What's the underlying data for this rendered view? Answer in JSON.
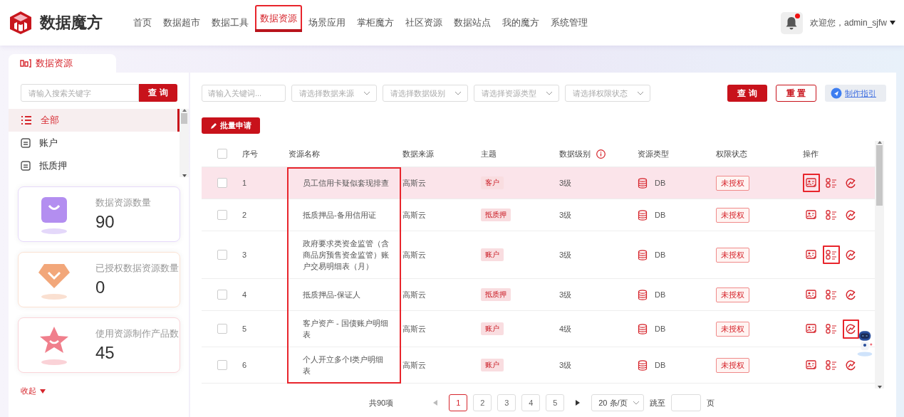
{
  "brand": {
    "name": "数据魔方"
  },
  "nav": [
    {
      "label": "首页",
      "selected": false,
      "annotated": false
    },
    {
      "label": "数据超市",
      "selected": false,
      "annotated": false
    },
    {
      "label": "数据工具",
      "selected": false,
      "annotated": false
    },
    {
      "label": "数据资源",
      "selected": true,
      "annotated": true
    },
    {
      "label": "场景应用",
      "selected": false,
      "annotated": false
    },
    {
      "label": "掌柜魔方",
      "selected": false,
      "annotated": false
    },
    {
      "label": "社区资源",
      "selected": false,
      "annotated": false
    },
    {
      "label": "数据站点",
      "selected": false,
      "annotated": false
    },
    {
      "label": "我的魔方",
      "selected": false,
      "annotated": false
    },
    {
      "label": "系统管理",
      "selected": false,
      "annotated": false
    }
  ],
  "user": {
    "notification": true,
    "welcome": "欢迎您，admin_sjfw"
  },
  "sidebar": {
    "tab": "数据资源",
    "search": {
      "placeholder": "请输入搜索关键字",
      "button": "查 询"
    },
    "categories": [
      {
        "label": "全部",
        "kind": "all",
        "selected": true
      },
      {
        "label": "账户",
        "kind": "table",
        "selected": false
      },
      {
        "label": "抵质押",
        "kind": "table",
        "selected": false
      }
    ],
    "stats": [
      {
        "label": "数据资源数量",
        "value": "90",
        "kind": "bag",
        "color": "#b38ef0"
      },
      {
        "label": "已授权数据资源数量",
        "value": "0",
        "kind": "gem",
        "color": "#f2a77a"
      },
      {
        "label": "使用资源制作产品数",
        "value": "45",
        "kind": "star",
        "color": "#f07f8c"
      }
    ],
    "collapse": "收起"
  },
  "filters": {
    "keyword_placeholder": "请输入关键词...",
    "selects": [
      "请选择数据来源",
      "请选择数据级别",
      "请选择资源类型",
      "请选择权限状态"
    ],
    "query": "查 询",
    "reset": "重 置",
    "guide": "制作指引"
  },
  "batch_button": "批量申请",
  "table": {
    "columns": [
      "序号",
      "资源名称",
      "数据来源",
      "主题",
      "数据级别",
      "资源类型",
      "权限状态",
      "操作"
    ],
    "name_column_annotated": true,
    "select_all_checked": false,
    "rows": [
      {
        "index": "1",
        "name": "员工信用卡疑似套现排查",
        "source": "高斯云",
        "topic": "客户",
        "level": "3级",
        "type": "DB",
        "status": "未授权",
        "checked": false,
        "highlighted": true,
        "actions": [
          {
            "kind": "card",
            "annotated": true
          },
          {
            "kind": "list",
            "annotated": false
          },
          {
            "kind": "chart",
            "annotated": false
          }
        ]
      },
      {
        "index": "2",
        "name": "抵质押品-备用信用证",
        "source": "高斯云",
        "topic": "抵质押",
        "level": "3级",
        "type": "DB",
        "status": "未授权",
        "checked": false,
        "highlighted": false,
        "actions": [
          {
            "kind": "card",
            "annotated": false
          },
          {
            "kind": "list",
            "annotated": false
          },
          {
            "kind": "chart",
            "annotated": false
          }
        ]
      },
      {
        "index": "3",
        "name": "政府要求类资金监管（含商品房预售资金监管）账户交易明细表（月）",
        "source": "高斯云",
        "topic": "账户",
        "level": "3级",
        "type": "DB",
        "status": "未授权",
        "checked": false,
        "highlighted": false,
        "actions": [
          {
            "kind": "card",
            "annotated": false
          },
          {
            "kind": "list",
            "annotated": true
          },
          {
            "kind": "chart",
            "annotated": false
          }
        ]
      },
      {
        "index": "4",
        "name": "抵质押品-保证人",
        "source": "高斯云",
        "topic": "抵质押",
        "level": "3级",
        "type": "DB",
        "status": "未授权",
        "checked": false,
        "highlighted": false,
        "actions": [
          {
            "kind": "card",
            "annotated": false
          },
          {
            "kind": "list",
            "annotated": false
          },
          {
            "kind": "chart",
            "annotated": false
          }
        ]
      },
      {
        "index": "5",
        "name": "客户资产 - 国债账户明细表",
        "source": "高斯云",
        "topic": "账户",
        "level": "4级",
        "type": "DB",
        "status": "未授权",
        "checked": false,
        "highlighted": false,
        "actions": [
          {
            "kind": "card",
            "annotated": false
          },
          {
            "kind": "list",
            "annotated": false
          },
          {
            "kind": "chart",
            "annotated": true
          }
        ]
      },
      {
        "index": "6",
        "name": "个人开立多个Ⅰ类户明细表",
        "source": "高斯云",
        "topic": "账户",
        "level": "3级",
        "type": "DB",
        "status": "未授权",
        "checked": false,
        "highlighted": false,
        "actions": [
          {
            "kind": "card",
            "annotated": false
          },
          {
            "kind": "list",
            "annotated": false
          },
          {
            "kind": "chart",
            "annotated": false
          }
        ]
      }
    ]
  },
  "pagination": {
    "total": "共90项",
    "pages": [
      {
        "label": "1",
        "selected": true
      },
      {
        "label": "2",
        "selected": false
      },
      {
        "label": "3",
        "selected": false
      },
      {
        "label": "4",
        "selected": false
      },
      {
        "label": "5",
        "selected": false
      }
    ],
    "page_size": "20 条/页",
    "jump_label": "跳至",
    "page_unit": "页"
  }
}
